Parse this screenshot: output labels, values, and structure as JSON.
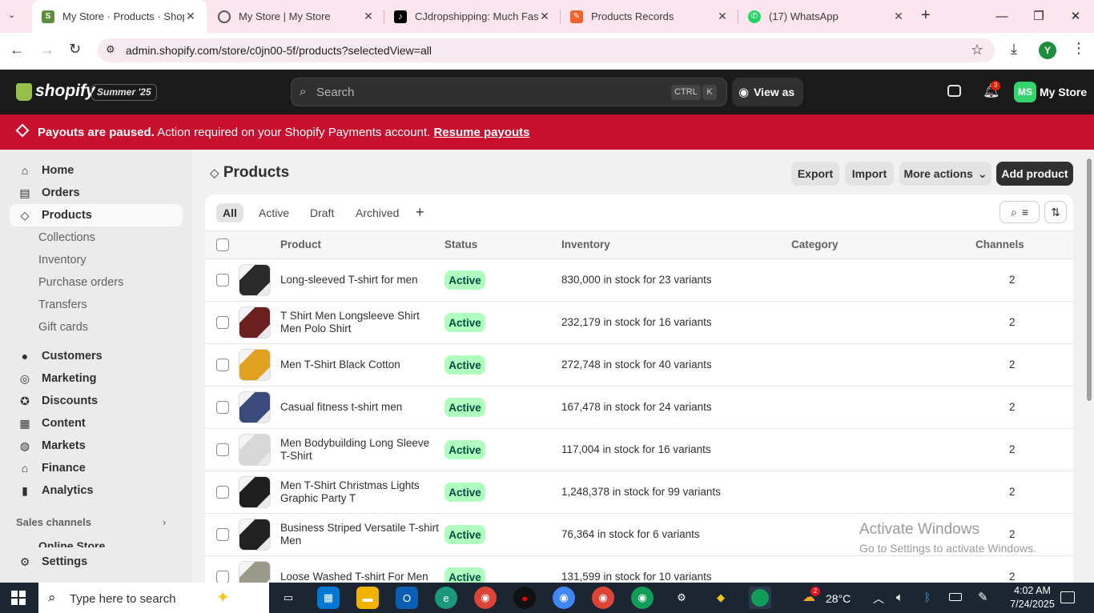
{
  "browser": {
    "tabs": [
      {
        "title": "My Store · Products · Shopify",
        "color": "#5e8e3e"
      },
      {
        "title": "My Store | My Store",
        "color": "#555555"
      },
      {
        "title": "CJdropshipping: Much Faste",
        "color": "#000000"
      },
      {
        "title": "Products Records",
        "color": "#f2642a"
      },
      {
        "title": "(17) WhatsApp",
        "color": "#25d366"
      }
    ],
    "url": "admin.shopify.com/store/c0jn00-5f/products?selectedView=all",
    "profile_initial": "Y"
  },
  "topbar": {
    "brand": "shopify",
    "edition": "Summer '25",
    "search_placeholder": "Search",
    "shortcut_key1": "CTRL",
    "shortcut_key2": "K",
    "view_as": "View as",
    "notif_count": "3",
    "store_initials": "MS",
    "store_name": "My Store"
  },
  "banner": {
    "bold": "Payouts are paused.",
    "text": "Action required on your Shopify Payments account.",
    "link": "Resume payouts"
  },
  "sidebar": {
    "items": [
      {
        "label": "Home",
        "icon": "home-icon"
      },
      {
        "label": "Orders",
        "icon": "orders-icon"
      },
      {
        "label": "Products",
        "icon": "tag-icon"
      }
    ],
    "subitems": [
      "Collections",
      "Inventory",
      "Purchase orders",
      "Transfers",
      "Gift cards"
    ],
    "items2": [
      {
        "label": "Customers",
        "icon": "person-icon"
      },
      {
        "label": "Marketing",
        "icon": "target-icon"
      },
      {
        "label": "Discounts",
        "icon": "discount-icon"
      },
      {
        "label": "Content",
        "icon": "content-icon"
      },
      {
        "label": "Markets",
        "icon": "globe-icon"
      },
      {
        "label": "Finance",
        "icon": "bank-icon"
      },
      {
        "label": "Analytics",
        "icon": "chart-icon"
      }
    ],
    "sales_channels": "Sales channels",
    "online_store": "Online Store",
    "settings": "Settings"
  },
  "page": {
    "title": "Products",
    "export": "Export",
    "import": "Import",
    "more_actions": "More actions",
    "add_product": "Add product",
    "views": [
      "All",
      "Active",
      "Draft",
      "Archived"
    ],
    "columns": {
      "product": "Product",
      "status": "Status",
      "inventory": "Inventory",
      "category": "Category",
      "channels": "Channels"
    }
  },
  "products": [
    {
      "name": "Long-sleeved T-shirt for men",
      "status": "Active",
      "inventory": "830,000 in stock for 23 variants",
      "channels": "2",
      "thumb": "#2a2a2a"
    },
    {
      "name": "T Shirt Men Longsleeve Shirt Men Polo Shirt",
      "status": "Active",
      "inventory": "232,179 in stock for 16 variants",
      "channels": "2",
      "thumb": "#6b1f1f"
    },
    {
      "name": "Men T-Shirt Black Cotton",
      "status": "Active",
      "inventory": "272,748 in stock for 40 variants",
      "channels": "2",
      "thumb": "#e0a020"
    },
    {
      "name": "Casual fitness t-shirt men",
      "status": "Active",
      "inventory": "167,478 in stock for 24 variants",
      "channels": "2",
      "thumb": "#3b4a7a"
    },
    {
      "name": "Men Bodybuilding Long Sleeve T-Shirt",
      "status": "Active",
      "inventory": "117,004 in stock for 16 variants",
      "channels": "2",
      "thumb": "#d8d8d8"
    },
    {
      "name": "Men T-Shirt Christmas Lights Graphic Party T",
      "status": "Active",
      "inventory": "1,248,378 in stock for 99 variants",
      "channels": "2",
      "thumb": "#1e1e1e"
    },
    {
      "name": "Business Striped Versatile T-shirt Men",
      "status": "Active",
      "inventory": "76,364 in stock for 6 variants",
      "channels": "2",
      "thumb": "#222222"
    },
    {
      "name": "Loose Washed T-shirt For Men",
      "status": "Active",
      "inventory": "131,599 in stock for 10 variants",
      "channels": "2",
      "thumb": "#9a9a8a"
    }
  ],
  "watermark": {
    "line1": "Activate Windows",
    "line2": "Go to Settings to activate Windows."
  },
  "taskbar": {
    "search_placeholder": "Type here to search",
    "temperature": "28°C",
    "time": "4:02 AM",
    "date": "7/24/2025",
    "weather_badge": "2"
  }
}
